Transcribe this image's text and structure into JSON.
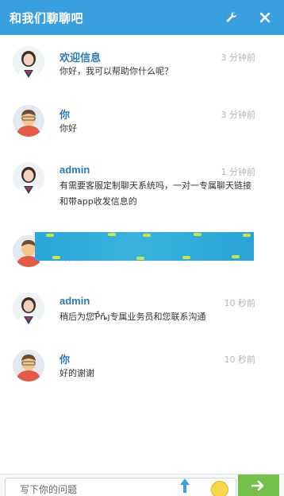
{
  "header": {
    "title": "和我们聊聊吧",
    "settings_icon": "wrench-icon",
    "close_icon": "close-icon",
    "accent_color": "#3a9fde"
  },
  "messages": [
    {
      "name": "欢迎信息",
      "time": "3 分钟前",
      "text": "你好，我可以帮助你什么呢？",
      "avatar": "agent"
    },
    {
      "name": "你",
      "time": "3 分钟前",
      "text": "你好",
      "avatar": "user"
    },
    {
      "name": "admin",
      "time": "1 分钟前",
      "text": "有需要客服定制聊天系统吗，一对一专属聊天链接和带app收发信息的",
      "avatar": "agent"
    },
    {
      "name": "",
      "time": "",
      "text": "需要，怎么弄",
      "avatar": "user"
    },
    {
      "name": "admin",
      "time": "10 秒前",
      "text": "稍后为您Ƥ̈́ȵ̈́ȷ专属业务员和您联系沟通",
      "avatar": "agent"
    },
    {
      "name": "你",
      "time": "10 秒前",
      "text": "好的谢谢",
      "avatar": "user"
    }
  ],
  "footer": {
    "input_placeholder": "写下你的问题",
    "upload_icon": "upload-arrow-icon",
    "emoji_icon": "emoji-icon",
    "send_icon": "send-arrow-icon",
    "send_color": "#74c04a"
  }
}
